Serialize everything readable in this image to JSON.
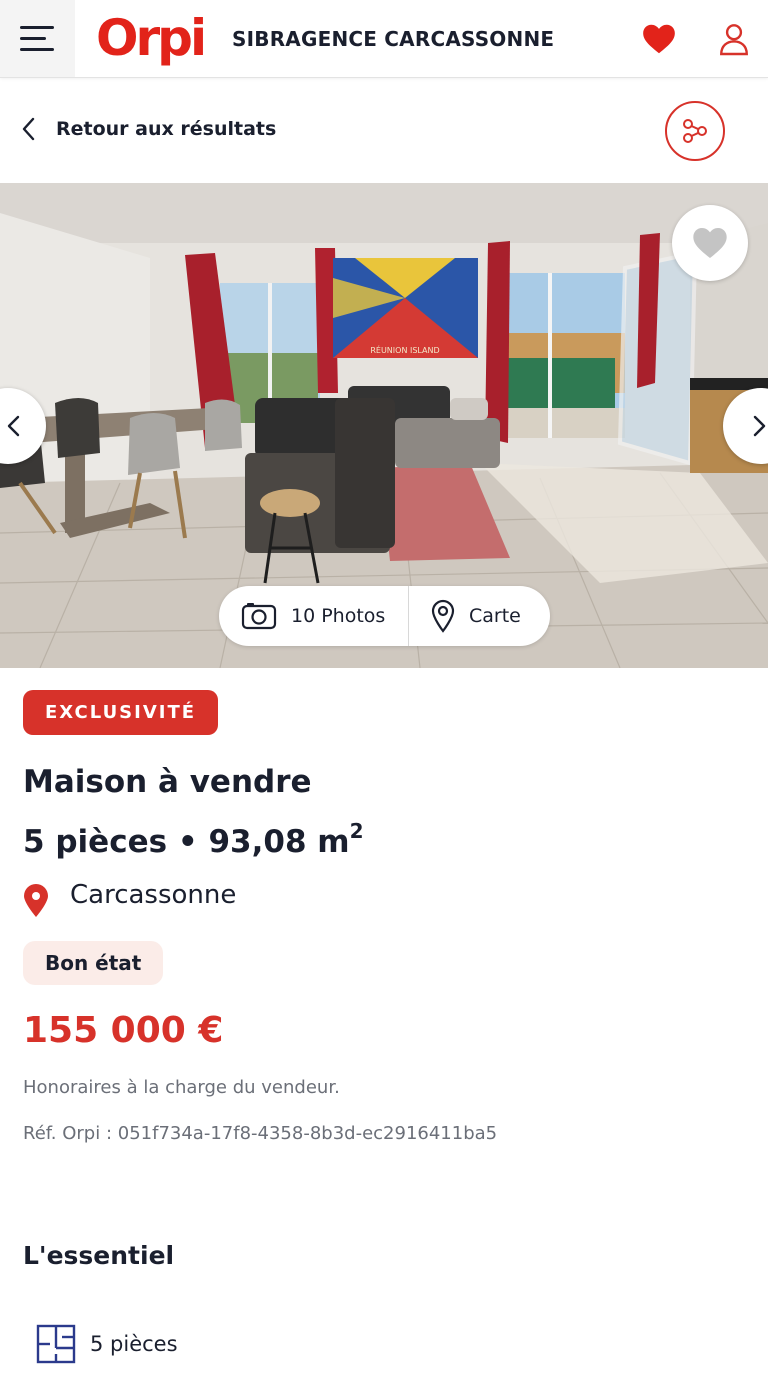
{
  "header": {
    "brand": "Orpi",
    "agency": "SIBRAGENCE CARCASSONNE",
    "menu_icon": "hamburger-menu-icon",
    "favorites_icon": "heart-icon",
    "account_icon": "user-icon",
    "accent_color": "#e2231a"
  },
  "nav": {
    "back_label": "Retour aux résultats",
    "share_icon": "share-icon"
  },
  "gallery": {
    "photos_label": "10 Photos",
    "map_label": "Carte",
    "flag_text": "RÉUNION ISLAND"
  },
  "listing": {
    "badge": "EXCLUSIVITÉ",
    "title": "Maison à vendre",
    "rooms_area": "5 pièces • 93,08 m",
    "area_unit_exponent": "2",
    "location": "Carcassonne",
    "condition": "Bon état",
    "price": "155 000 €",
    "fees": "Honoraires à la charge du vendeur.",
    "reference": "Réf. Orpi : 051f734a-17f8-4358-8b3d-ec2916411ba5",
    "price_color": "#d7322a"
  },
  "essentials": {
    "title": "L'essentiel",
    "items": [
      {
        "label": "5 pièces",
        "icon": "floor-plan-icon"
      }
    ]
  }
}
